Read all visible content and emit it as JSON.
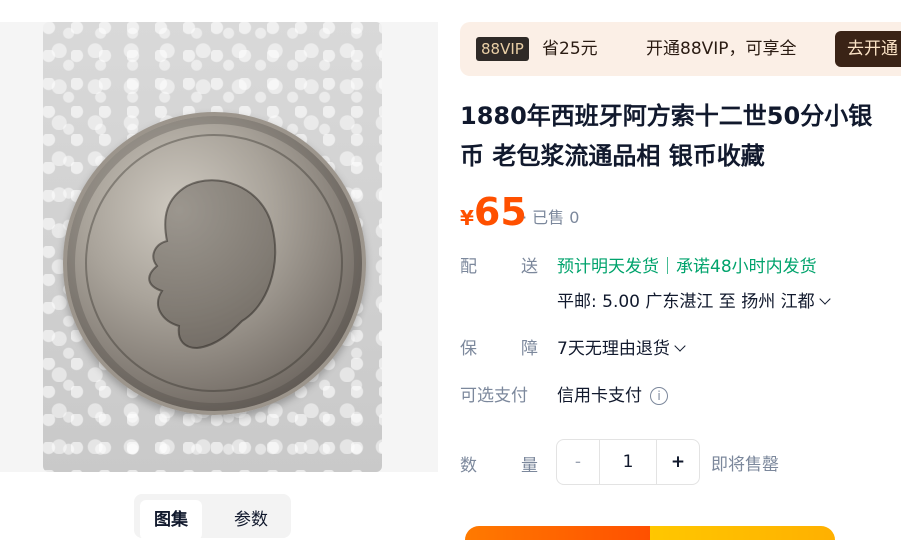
{
  "gallery": {
    "tabs": [
      "图集",
      "参数"
    ]
  },
  "vip": {
    "badge": "88VIP",
    "save": "省25元",
    "open_text": "开通88VIP，可享全",
    "button": "去开通"
  },
  "product": {
    "title_line1": "1880年西班牙阿方索十二世50分小银",
    "title_line2": "币 老包浆流通品相 银币收藏",
    "price_symbol": "¥",
    "price": "65",
    "sold": "· 已售 0"
  },
  "delivery": {
    "label_a": "配",
    "label_b": "送",
    "promise": "预计明天发货｜承诺48小时内发货",
    "shipping": "平邮: 5.00  广东湛江  至  扬州 江都"
  },
  "guarantee": {
    "label_a": "保",
    "label_b": "障",
    "value": "7天无理由退货"
  },
  "payment": {
    "label": "可选支付",
    "value": "信用卡支付",
    "info_icon": "i"
  },
  "quantity": {
    "label_a": "数",
    "label_b": "量",
    "minus": "-",
    "value": "1",
    "plus": "+",
    "status": "即将售罄"
  },
  "colors": {
    "price": "#ff5000",
    "green": "#00a36c",
    "vip_bg": "#fbefe6"
  }
}
